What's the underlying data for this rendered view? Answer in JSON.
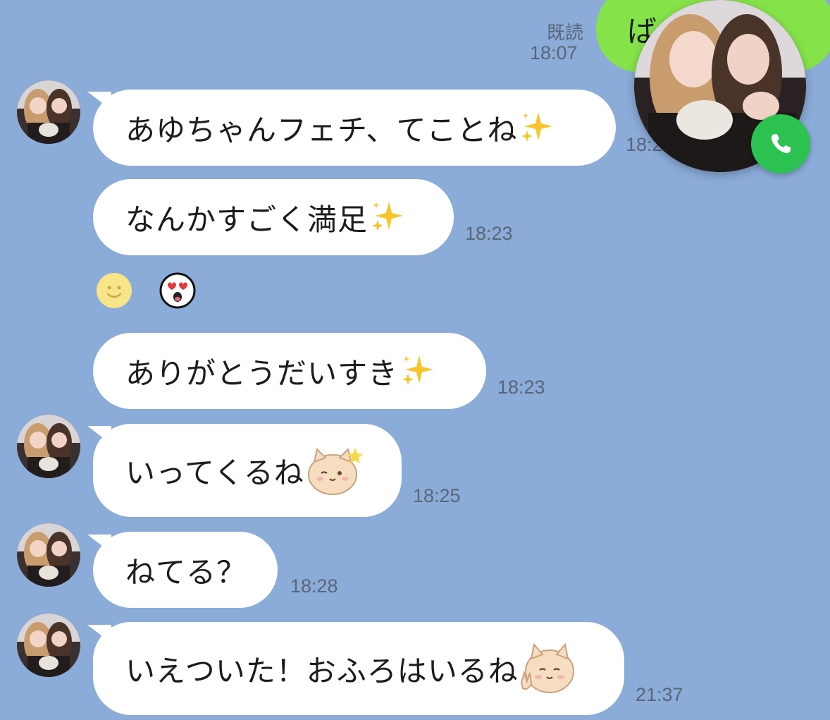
{
  "colors": {
    "background": "#8BABD8",
    "incoming_bubble": "#FFFFFF",
    "outgoing_bubble": "#85E249",
    "timestamp": "#5A6577",
    "call_button": "#2BC251"
  },
  "outgoing": {
    "text": "ば",
    "read_label": "既読",
    "time": "18:07"
  },
  "call_overlay": {
    "icon": "phone-icon",
    "avatar": "contact-photo"
  },
  "messages": [
    {
      "text": "あゆちゃんフェチ、てことね",
      "emoji": "sparkles",
      "time": "18:2",
      "show_avatar": true
    },
    {
      "text": "なんかすごく満足",
      "emoji": "sparkles",
      "time": "18:23",
      "show_avatar": false
    },
    {
      "stickers": [
        "smiley-face",
        "heart-eyes-face"
      ],
      "time": ""
    },
    {
      "text": "ありがとうだいすき",
      "emoji": "sparkles",
      "time": "18:23",
      "show_avatar": false
    },
    {
      "text": "いってくるね",
      "emoji": "cat-wink-sticker",
      "time": "18:25",
      "show_avatar": true
    },
    {
      "text": "ねてる？",
      "emoji": "",
      "time": "18:28",
      "show_avatar": true
    },
    {
      "text": "いえついた！おふろはいるね",
      "emoji": "cat-peace-sticker",
      "time": "21:37",
      "show_avatar": true
    }
  ]
}
